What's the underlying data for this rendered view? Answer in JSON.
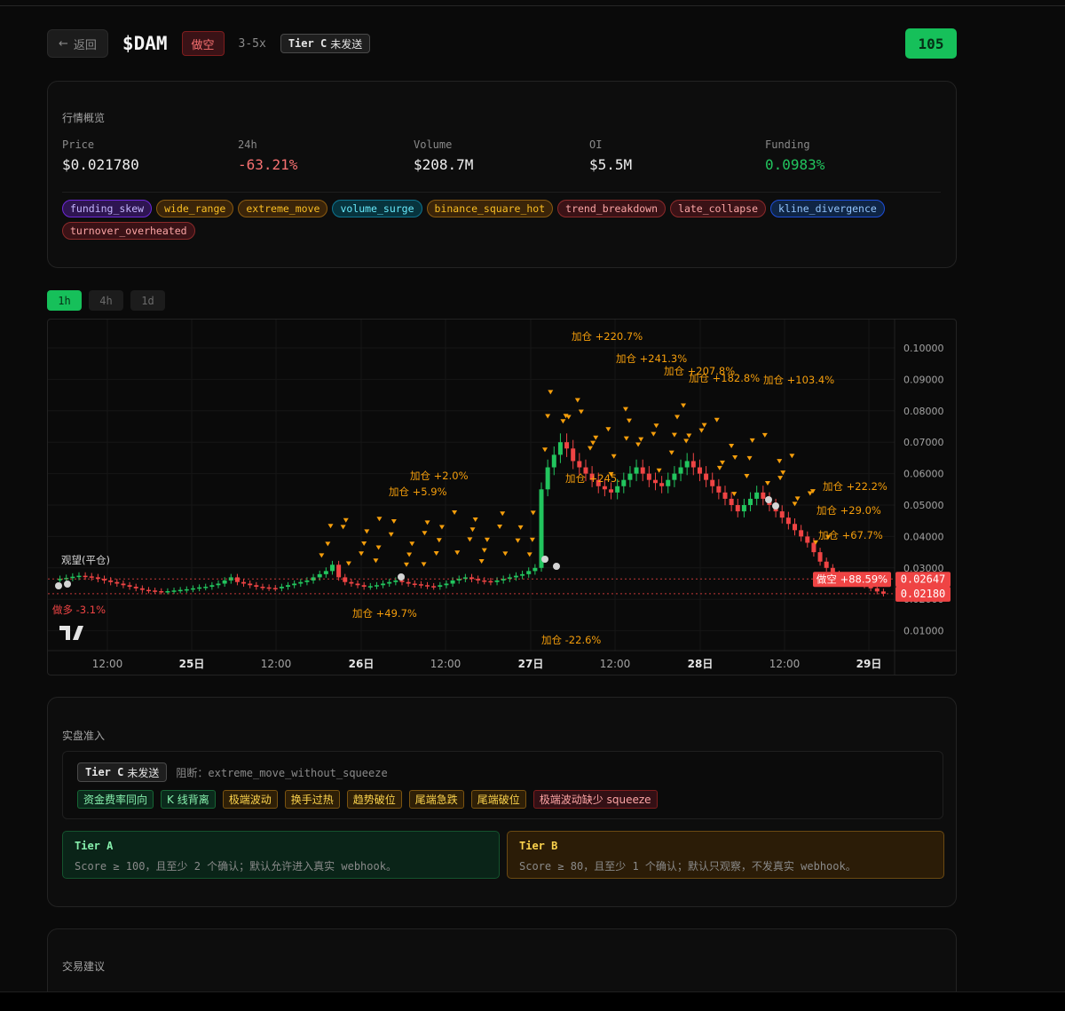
{
  "header": {
    "back_label": "返回",
    "symbol": "$DAM",
    "direction": "做空",
    "leverage": "3-5x",
    "tier": {
      "name": "Tier C",
      "status": "未发送"
    },
    "score": "105"
  },
  "overview": {
    "title": "行情概览",
    "stats": [
      {
        "label": "Price",
        "value": "$0.021780"
      },
      {
        "label": "24h",
        "value": "-63.21%"
      },
      {
        "label": "Volume",
        "value": "$208.7M"
      },
      {
        "label": "OI",
        "value": "$5.5M"
      },
      {
        "label": "Funding",
        "value": "0.0983%"
      }
    ],
    "tags": [
      "funding_skew",
      "wide_range",
      "extreme_move",
      "volume_surge",
      "binance_square_hot",
      "trend_breakdown",
      "late_collapse",
      "kline_divergence",
      "turnover_overheated"
    ]
  },
  "timeframes": [
    "1h",
    "4h",
    "1d"
  ],
  "chart_data": {
    "type": "candlestick",
    "title": "",
    "x_ticks": [
      "12:00",
      "25日",
      "12:00",
      "26日",
      "12:00",
      "27日",
      "12:00",
      "28日",
      "12:00",
      "29日"
    ],
    "y_ticks": [
      "0.10000",
      "0.09000",
      "0.08000",
      "0.07000",
      "0.06000",
      "0.05000",
      "0.04000",
      "0.03000",
      "0.02000",
      "0.01000"
    ],
    "ylim": [
      0.0,
      0.105
    ],
    "price_lines": [
      {
        "label": "0.02647",
        "value": 0.02647,
        "color": "#ef4444"
      },
      {
        "label": "0.02180",
        "value": 0.0218,
        "color": "#ef4444"
      }
    ],
    "position_label": "做空 +88.59%",
    "annotations": [
      "加仓 +220.7%",
      "加仓 +241.3%",
      "加仓 +207.8%",
      "加仓 +182.8%",
      "加仓 +103.4%",
      "加仓 +245.",
      "加仓 +2.0%",
      "加仓 +5.9%",
      "加仓 +22.2%",
      "加仓 +29.0%",
      "加仓 +67.7%",
      "加仓 -22.6%",
      "加仓 +49.7%",
      "做多 -3.1%",
      "观望(平仓)"
    ],
    "price_series": [
      0.0265,
      0.0268,
      0.0272,
      0.0275,
      0.0273,
      0.027,
      0.0265,
      0.026,
      0.0255,
      0.025,
      0.0245,
      0.024,
      0.0235,
      0.023,
      0.0228,
      0.0226,
      0.0225,
      0.0226,
      0.0228,
      0.023,
      0.0232,
      0.0235,
      0.0238,
      0.024,
      0.0245,
      0.025,
      0.026,
      0.027,
      0.0255,
      0.025,
      0.0245,
      0.024,
      0.0238,
      0.0236,
      0.0235,
      0.024,
      0.0245,
      0.025,
      0.0255,
      0.026,
      0.027,
      0.028,
      0.029,
      0.031,
      0.027,
      0.0255,
      0.025,
      0.0245,
      0.024,
      0.0242,
      0.0245,
      0.025,
      0.0255,
      0.026,
      0.0255,
      0.025,
      0.0248,
      0.0245,
      0.0242,
      0.024,
      0.0245,
      0.025,
      0.026,
      0.0265,
      0.027,
      0.0265,
      0.026,
      0.0258,
      0.0255,
      0.026,
      0.0265,
      0.027,
      0.0275,
      0.028,
      0.029,
      0.03,
      0.055,
      0.062,
      0.066,
      0.07,
      0.068,
      0.064,
      0.062,
      0.06,
      0.058,
      0.056,
      0.055,
      0.054,
      0.056,
      0.058,
      0.06,
      0.062,
      0.06,
      0.058,
      0.057,
      0.056,
      0.058,
      0.06,
      0.062,
      0.064,
      0.062,
      0.06,
      0.058,
      0.056,
      0.054,
      0.052,
      0.05,
      0.048,
      0.05,
      0.052,
      0.054,
      0.052,
      0.05,
      0.048,
      0.046,
      0.044,
      0.042,
      0.04,
      0.038,
      0.035,
      0.032,
      0.03,
      0.028,
      0.0265,
      0.026,
      0.0255,
      0.025,
      0.0245,
      0.0235,
      0.0225,
      0.0218
    ]
  },
  "gate": {
    "title": "实盘准入",
    "tier": {
      "name": "Tier C",
      "status": "未发送"
    },
    "block_label": "阻断：",
    "block_reason": "extreme_move_without_squeeze",
    "chips": [
      {
        "label": "资金费率同向",
        "tone": "green"
      },
      {
        "label": "K 线背离",
        "tone": "green"
      },
      {
        "label": "极端波动",
        "tone": "orange"
      },
      {
        "label": "换手过热",
        "tone": "orange"
      },
      {
        "label": "趋势破位",
        "tone": "orange"
      },
      {
        "label": "尾端急跌",
        "tone": "orange"
      },
      {
        "label": "尾端破位",
        "tone": "orange"
      },
      {
        "label": "极端波动缺少 squeeze",
        "tone": "red"
      }
    ],
    "tier_a": {
      "title": "Tier A",
      "desc": "Score ≥ 100，且至少 2 个确认；默认允许进入真实 webhook。"
    },
    "tier_b": {
      "title": "Tier B",
      "desc": "Score ≥ 80，且至少 1 个确认；默认只观察，不发真实 webhook。"
    }
  },
  "advice": {
    "title": "交易建议"
  },
  "colors": {
    "accent": "#16c05a",
    "up": "#22c55e",
    "down": "#ef4444",
    "annotation": "#f59e0b"
  }
}
